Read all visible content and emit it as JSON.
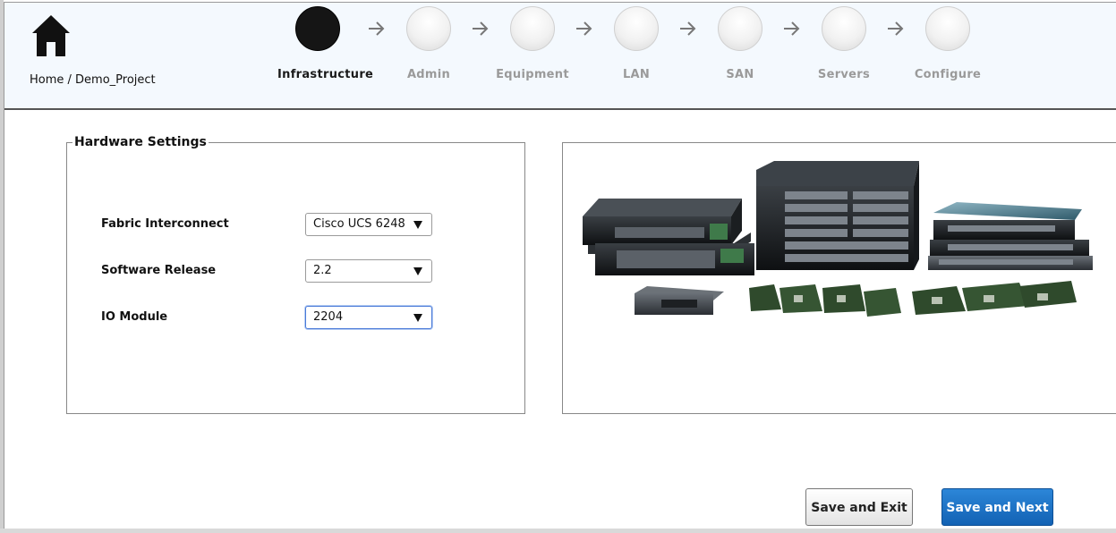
{
  "header": {
    "breadcrumb": "Home / Demo_Project",
    "steps": [
      {
        "label": "Infrastructure",
        "active": true
      },
      {
        "label": "Admin",
        "active": false
      },
      {
        "label": "Equipment",
        "active": false
      },
      {
        "label": "LAN",
        "active": false
      },
      {
        "label": "SAN",
        "active": false
      },
      {
        "label": "Servers",
        "active": false
      },
      {
        "label": "Configure",
        "active": false
      }
    ]
  },
  "hardware": {
    "title": "Hardware Settings",
    "fields": [
      {
        "label": "Fabric Interconnect",
        "value": "Cisco UCS 6248"
      },
      {
        "label": "Software Release",
        "value": "2.2"
      },
      {
        "label": "IO Module",
        "value": "2204"
      }
    ]
  },
  "buttons": {
    "save_exit": "Save and Exit",
    "save_next": "Save and Next"
  },
  "colors": {
    "accent": "#1a6fc4",
    "header_bg": "#f4f9fe",
    "active_step": "#151515"
  },
  "icons": {
    "home": "home-icon",
    "arrow": "arrow-right-icon",
    "dropdown": "chevron-down-icon"
  }
}
